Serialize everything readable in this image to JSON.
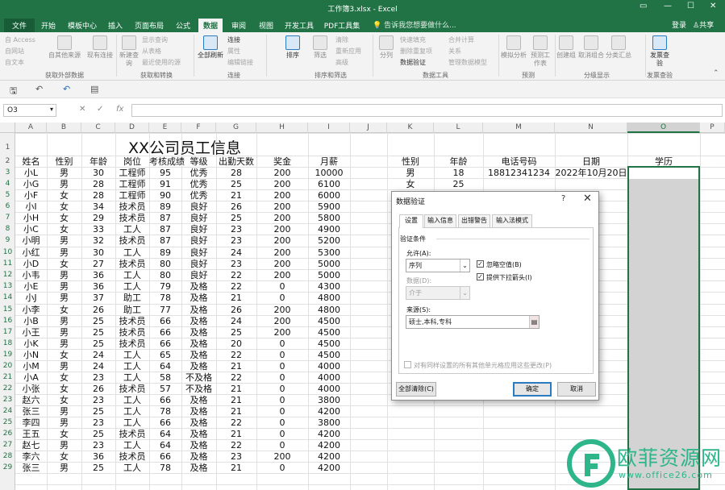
{
  "window": {
    "title": "工作簿3.xlsx - Excel"
  },
  "tabs": [
    "文件",
    "开始",
    "模板中心",
    "插入",
    "页面布局",
    "公式",
    "数据",
    "审阅",
    "视图",
    "开发工具",
    "PDF工具集"
  ],
  "tell_me": "告诉我您想要做什么...",
  "account": {
    "login": "登录",
    "share": "共享"
  },
  "ribbon": {
    "get_external": [
      "自 Access",
      "自网站",
      "自文本",
      "自其他来源",
      "现有连接"
    ],
    "get_transform": [
      "新建查询",
      "显示查询",
      "从表格",
      "最近使用的源"
    ],
    "connections": [
      "全部刷新",
      "连接",
      "属性",
      "编辑链接"
    ],
    "sort_filter": [
      "排序",
      "筛选",
      "清除",
      "重新应用",
      "高级"
    ],
    "data_tools": [
      "分列",
      "快速填充",
      "删除重复项",
      "数据验证",
      "合并计算",
      "关系",
      "管理数据模型"
    ],
    "forecast": [
      "模拟分析",
      "预测工作表"
    ],
    "outline": [
      "创建组",
      "取消组合",
      "分类汇总"
    ],
    "invoice": [
      "发票查验"
    ],
    "groups": [
      "获取外部数据",
      "获取和转换",
      "连接",
      "排序和筛选",
      "数据工具",
      "预测",
      "分级显示",
      "发票查验"
    ]
  },
  "formula_bar": {
    "name_box": "O3",
    "fx": "fx",
    "value": ""
  },
  "columns": [
    "A",
    "B",
    "C",
    "D",
    "E",
    "F",
    "G",
    "H",
    "I",
    "J",
    "K",
    "L",
    "M",
    "N",
    "O",
    "P"
  ],
  "rows": [
    "1",
    "2",
    "3",
    "4",
    "5",
    "6",
    "7",
    "8",
    "9",
    "10",
    "11",
    "12",
    "13",
    "14",
    "15",
    "16",
    "17",
    "18",
    "19",
    "20",
    "21",
    "22",
    "23",
    "24",
    "25",
    "26",
    "27",
    "28",
    "29"
  ],
  "sheet": {
    "title": "XX公司员工信息",
    "headers": [
      "姓名",
      "性别",
      "年龄",
      "岗位",
      "考核成绩",
      "等级",
      "出勤天数",
      "奖金",
      "月薪"
    ],
    "rows": [
      [
        "小L",
        "男",
        "30",
        "工程师",
        "95",
        "优秀",
        "28",
        "200",
        "10000"
      ],
      [
        "小G",
        "男",
        "28",
        "工程师",
        "91",
        "优秀",
        "25",
        "200",
        "6100"
      ],
      [
        "小F",
        "女",
        "28",
        "工程师",
        "90",
        "优秀",
        "21",
        "200",
        "6000"
      ],
      [
        "小I",
        "女",
        "34",
        "技术员",
        "89",
        "良好",
        "26",
        "200",
        "5900"
      ],
      [
        "小H",
        "女",
        "29",
        "技术员",
        "87",
        "良好",
        "25",
        "200",
        "5800"
      ],
      [
        "小C",
        "女",
        "33",
        "工人",
        "87",
        "良好",
        "23",
        "200",
        "4900"
      ],
      [
        "小明",
        "男",
        "32",
        "技术员",
        "87",
        "良好",
        "23",
        "200",
        "5200"
      ],
      [
        "小红",
        "男",
        "30",
        "工人",
        "89",
        "良好",
        "24",
        "200",
        "5300"
      ],
      [
        "小D",
        "女",
        "27",
        "技术员",
        "80",
        "良好",
        "23",
        "200",
        "5000"
      ],
      [
        "小韦",
        "男",
        "36",
        "工人",
        "80",
        "良好",
        "22",
        "200",
        "5000"
      ],
      [
        "小E",
        "男",
        "36",
        "工人",
        "79",
        "及格",
        "22",
        "0",
        "4300"
      ],
      [
        "小J",
        "男",
        "37",
        "助工",
        "78",
        "及格",
        "21",
        "0",
        "4800"
      ],
      [
        "小李",
        "女",
        "26",
        "助工",
        "77",
        "及格",
        "26",
        "200",
        "4800"
      ],
      [
        "小B",
        "男",
        "25",
        "技术员",
        "66",
        "及格",
        "24",
        "200",
        "4500"
      ],
      [
        "小王",
        "男",
        "25",
        "技术员",
        "66",
        "及格",
        "25",
        "200",
        "4500"
      ],
      [
        "小K",
        "男",
        "25",
        "技术员",
        "66",
        "及格",
        "20",
        "0",
        "4500"
      ],
      [
        "小N",
        "女",
        "24",
        "工人",
        "65",
        "及格",
        "22",
        "0",
        "4500"
      ],
      [
        "小M",
        "男",
        "24",
        "工人",
        "64",
        "及格",
        "21",
        "0",
        "4000"
      ],
      [
        "小A",
        "女",
        "23",
        "工人",
        "58",
        "不及格",
        "22",
        "0",
        "4000"
      ],
      [
        "小张",
        "女",
        "26",
        "技术员",
        "57",
        "不及格",
        "21",
        "0",
        "4000"
      ],
      [
        "赵六",
        "女",
        "23",
        "工人",
        "66",
        "及格",
        "21",
        "0",
        "3800"
      ],
      [
        "张三",
        "男",
        "25",
        "工人",
        "78",
        "及格",
        "21",
        "0",
        "4200"
      ],
      [
        "李四",
        "男",
        "23",
        "工人",
        "66",
        "及格",
        "22",
        "0",
        "3800"
      ],
      [
        "王五",
        "女",
        "25",
        "技术员",
        "64",
        "及格",
        "21",
        "0",
        "4200"
      ],
      [
        "赵七",
        "男",
        "23",
        "工人",
        "64",
        "及格",
        "22",
        "0",
        "4200"
      ],
      [
        "李六",
        "女",
        "36",
        "技术员",
        "66",
        "及格",
        "23",
        "200",
        "4200"
      ],
      [
        "张三",
        "男",
        "25",
        "工人",
        "78",
        "及格",
        "21",
        "0",
        "4200"
      ]
    ],
    "side_headers": [
      "性别",
      "年龄",
      "电话号码",
      "日期",
      "学历"
    ],
    "side_rows": [
      [
        "男",
        "18",
        "18812341234",
        "2022年10月20日",
        ""
      ],
      [
        "女",
        "25",
        "",
        "",
        ""
      ]
    ]
  },
  "dialog": {
    "title": "数据验证",
    "help": "?",
    "close": "✕",
    "tabs": [
      "设置",
      "输入信息",
      "出错警告",
      "输入法模式"
    ],
    "section": "验证条件",
    "allow_label": "允许(A):",
    "allow_value": "序列",
    "data_label": "数据(D):",
    "data_value": "介于",
    "ignore_blank": "忽略空值(B)",
    "dropdown": "提供下拉箭头(I)",
    "source_label": "来源(S):",
    "source_value": "硕士,本科,专科",
    "apply_all": "对有同样设置的所有其他单元格应用这些更改(P)",
    "clear": "全部清除(C)",
    "ok": "确定",
    "cancel": "取消"
  },
  "watermark": {
    "text": "欧菲资源网",
    "sub": "www.office26.com",
    "color": "#2fb58a"
  }
}
